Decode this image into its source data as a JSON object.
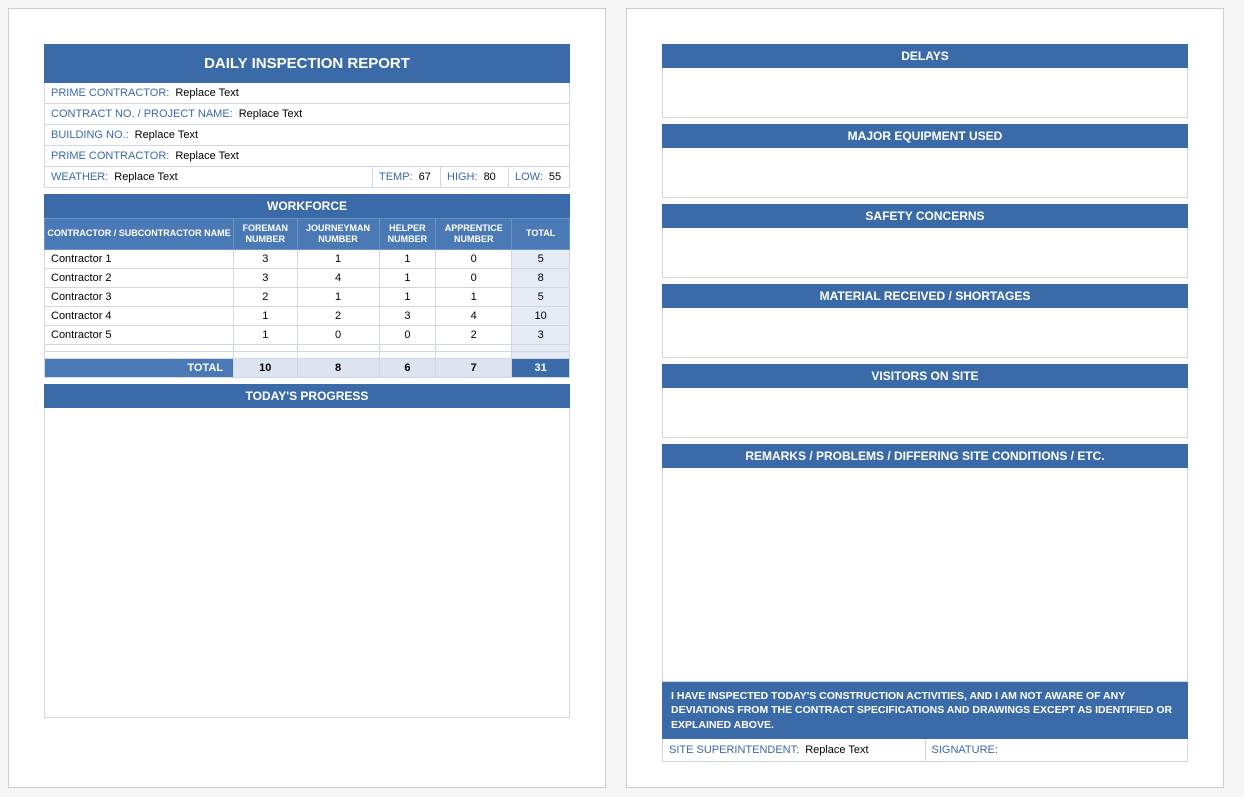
{
  "title": "DAILY INSPECTION REPORT",
  "fields": {
    "prime_contractor_label": "PRIME CONTRACTOR:",
    "prime_contractor_value": "Replace Text",
    "contract_label": "CONTRACT NO. / PROJECT NAME:",
    "contract_value": "Replace Text",
    "building_label": "BUILDING NO.:",
    "building_value": "Replace Text",
    "prime_contractor2_label": "PRIME CONTRACTOR:",
    "prime_contractor2_value": "Replace Text",
    "weather_label": "WEATHER:",
    "weather_value": "Replace Text",
    "temp_label": "TEMP:",
    "temp_value": "67",
    "high_label": "HIGH:",
    "high_value": "80",
    "low_label": "LOW:",
    "low_value": "55"
  },
  "workforce": {
    "header": "WORKFORCE",
    "cols": {
      "name": "CONTRACTOR / SUBCONTRACTOR NAME",
      "foreman": "FOREMAN NUMBER",
      "journeyman": "JOURNEYMAN NUMBER",
      "helper": "HELPER NUMBER",
      "apprentice": "APPRENTICE NUMBER",
      "total": "TOTAL"
    },
    "rows": [
      {
        "name": "Contractor 1",
        "foreman": "3",
        "journeyman": "1",
        "helper": "1",
        "apprentice": "0",
        "total": "5"
      },
      {
        "name": "Contractor 2",
        "foreman": "3",
        "journeyman": "4",
        "helper": "1",
        "apprentice": "0",
        "total": "8"
      },
      {
        "name": "Contractor 3",
        "foreman": "2",
        "journeyman": "1",
        "helper": "1",
        "apprentice": "1",
        "total": "5"
      },
      {
        "name": "Contractor 4",
        "foreman": "1",
        "journeyman": "2",
        "helper": "3",
        "apprentice": "4",
        "total": "10"
      },
      {
        "name": "Contractor 5",
        "foreman": "1",
        "journeyman": "0",
        "helper": "0",
        "apprentice": "2",
        "total": "3"
      },
      {
        "name": "",
        "foreman": "",
        "journeyman": "",
        "helper": "",
        "apprentice": "",
        "total": ""
      },
      {
        "name": "",
        "foreman": "",
        "journeyman": "",
        "helper": "",
        "apprentice": "",
        "total": ""
      }
    ],
    "totals_label": "TOTAL",
    "totals": {
      "foreman": "10",
      "journeyman": "8",
      "helper": "6",
      "apprentice": "7",
      "total": "31"
    }
  },
  "progress_header": "TODAY'S PROGRESS",
  "page2": {
    "delays": "DELAYS",
    "equipment": "MAJOR EQUIPMENT USED",
    "safety": "SAFETY CONCERNS",
    "material": "MATERIAL RECEIVED / SHORTAGES",
    "visitors": "VISITORS ON SITE",
    "remarks": "REMARKS / PROBLEMS / DIFFERING SITE CONDITIONS / ETC.",
    "certification": "I HAVE INSPECTED TODAY'S CONSTRUCTION ACTIVITIES, AND I AM NOT AWARE OF ANY DEVIATIONS FROM THE CONTRACT SPECIFICATIONS AND DRAWINGS EXCEPT AS IDENTIFIED OR EXPLAINED ABOVE.",
    "super_label": "SITE SUPERINTENDENT:",
    "super_value": "Replace Text",
    "sig_label": "SIGNATURE:"
  },
  "chart_data": {
    "type": "table",
    "title": "Workforce",
    "columns": [
      "Contractor / Subcontractor Name",
      "Foreman Number",
      "Journeyman Number",
      "Helper Number",
      "Apprentice Number",
      "Total"
    ],
    "rows": [
      [
        "Contractor 1",
        3,
        1,
        1,
        0,
        5
      ],
      [
        "Contractor 2",
        3,
        4,
        1,
        0,
        8
      ],
      [
        "Contractor 3",
        2,
        1,
        1,
        1,
        5
      ],
      [
        "Contractor 4",
        1,
        2,
        3,
        4,
        10
      ],
      [
        "Contractor 5",
        1,
        0,
        0,
        2,
        3
      ]
    ],
    "totals": [
      "TOTAL",
      10,
      8,
      6,
      7,
      31
    ]
  }
}
